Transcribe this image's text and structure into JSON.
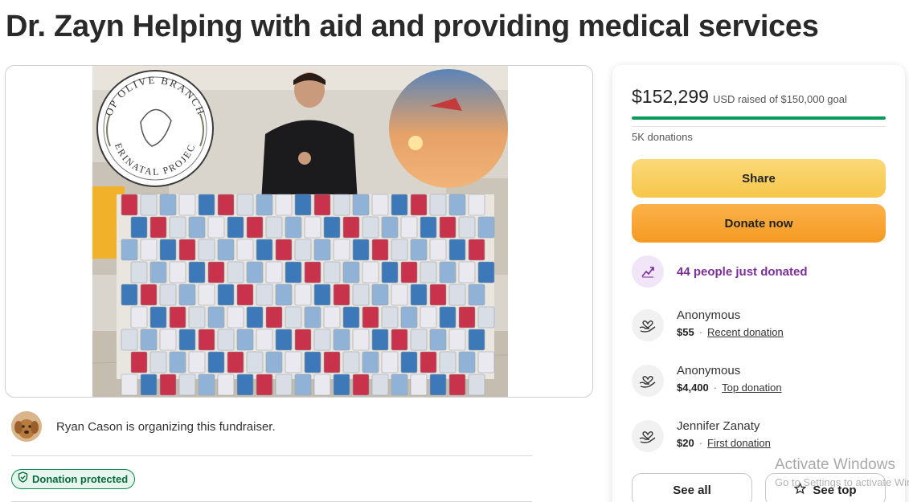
{
  "page": {
    "title": "Dr. Zayn Helping with aid and providing medical services"
  },
  "hero": {
    "badge_top_text": "OP OLIVE BRANCH",
    "badge_bottom_text": "PERINATAL PROJECT"
  },
  "organizer": {
    "text": "Ryan Cason is organizing this fundraiser."
  },
  "protection": {
    "badge_label": "Donation protected"
  },
  "donation_panel": {
    "raised_amount": "$152,299",
    "raised_caption": "USD raised of $150,000 goal",
    "progress_fraction": 1.0,
    "donation_count": "5K donations",
    "share_label": "Share",
    "donate_label": "Donate now",
    "recent_activity": "44 people just donated",
    "donations": [
      {
        "name": "Anonymous",
        "amount": "$55",
        "tag": "Recent donation"
      },
      {
        "name": "Anonymous",
        "amount": "$4,400",
        "tag": "Top donation"
      },
      {
        "name": "Jennifer Zanaty",
        "amount": "$20",
        "tag": "First donation"
      }
    ],
    "see_all_label": "See all",
    "see_top_label": "See top"
  },
  "os_overlay": {
    "title": "Activate Windows",
    "subtitle": "Go to Settings to activate Windows."
  },
  "colors": {
    "progress": "#0c9a5a",
    "share_button": "#f6c64a",
    "donate_button": "#f59a22",
    "recent_activity": "#7a2e9a",
    "protected_badge": "#0a8a4c"
  },
  "icons": {
    "protected": "shield-check-icon",
    "recent": "trending-up-icon",
    "donor": "heart-hands-icon",
    "see_top": "star-icon"
  }
}
